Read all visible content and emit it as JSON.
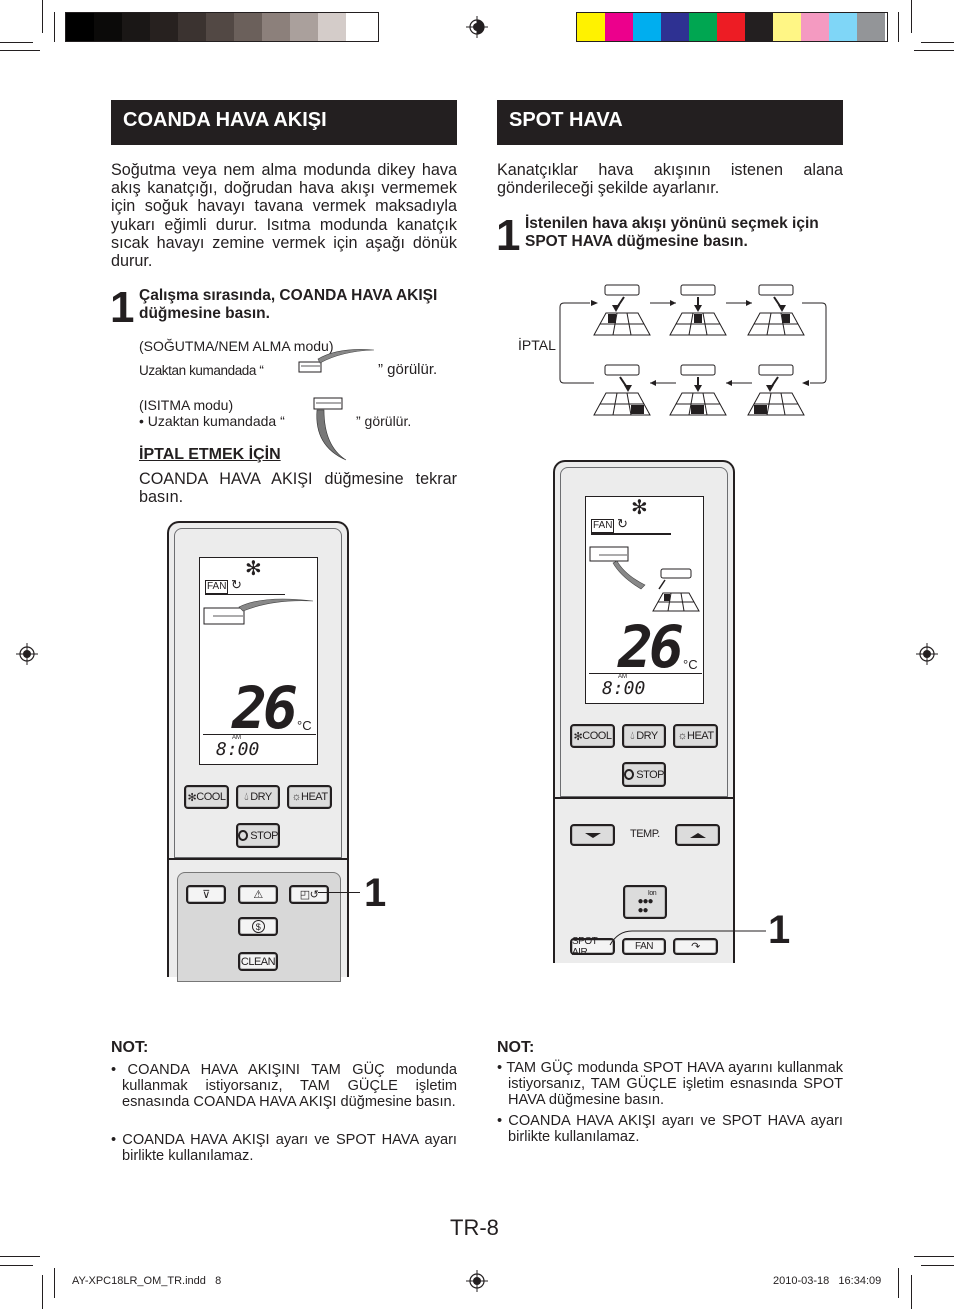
{
  "print_marks": {
    "gray_swatches": [
      "#000000",
      "#0b0a09",
      "#1a1716",
      "#27211f",
      "#3b3330",
      "#524844",
      "#6b605b",
      "#8c807b",
      "#aaa09c",
      "#d4ccc9",
      "#ffffff"
    ],
    "color_swatches": [
      "#fff200",
      "#ec008c",
      "#00aeef",
      "#2e3192",
      "#00a651",
      "#ed1c24",
      "#231f20",
      "#fff685",
      "#f49ac1",
      "#7fd6f7",
      "#939598"
    ]
  },
  "left": {
    "header": "COANDA HAVA AKIŞI",
    "intro": "Soğutma veya nem alma modunda dikey hava akış kanatçığı, doğrudan hava akışı vermemek için soğuk havayı tavana vermek maksadıyla yukarı eğimli durur. Isıtma modunda kanatçık sıcak havayı zemine vermek için aşağı dönük durur.",
    "step_number": "1",
    "step_text": "Çalışma sırasında, COANDA HAVA AKIŞI düğmesine basın.",
    "cool_mode_label": "(SOĞUTMA/NEM ALMA modu)",
    "cool_mode_line_a": "Uzaktan kumandada “",
    "cool_mode_line_b": "” görülür.",
    "heat_mode_label": "(ISITMA  modu)",
    "heat_mode_line_a": "• Uzaktan kumandada “",
    "heat_mode_line_b": "” görülür.",
    "cancel_heading": "İPTAL ETMEK İÇİN",
    "cancel_text": "COANDA HAVA AKIŞI düğmesine tekrar basın.",
    "remote": {
      "fan_label": "FAN",
      "temperature": "26",
      "unit": "°C",
      "am": "AM",
      "clock": "8:00",
      "buttons": {
        "cool": "COOL",
        "dry": "DRY",
        "heat": "HEAT",
        "stop": "STOP",
        "clean": "CLEAN"
      },
      "callout": "1"
    },
    "note_heading": "NOT:",
    "notes": [
      "• COANDA HAVA AKIŞINI TAM GÜÇ modunda kullanmak istiyorsanız, TAM GÜÇLE işletim esnasında COANDA HAVA AKIŞI düğmesine basın.",
      "• COANDA HAVA AKIŞI ayarı ve SPOT HAVA ayarı birlikte kullanılamaz."
    ]
  },
  "right": {
    "header": "SPOT HAVA",
    "intro": "Kanatçıklar hava akışının istenen alana gönderileceği şekilde ayarlanır.",
    "step_number": "1",
    "step_text": "İstenilen hava akışı yönünü seçmek için SPOT HAVA düğmesine basın.",
    "diagram": {
      "cancel_label": "İPTAL",
      "sequence": [
        "top-left",
        "top-center",
        "top-right",
        "bottom-left",
        "bottom-center",
        "bottom-right"
      ]
    },
    "remote": {
      "fan_label": "FAN",
      "temperature": "26",
      "unit": "°C",
      "am": "AM",
      "clock": "8:00",
      "buttons": {
        "cool": "COOL",
        "dry": "DRY",
        "heat": "HEAT",
        "stop": "STOP",
        "temp": "TEMP.",
        "ion": "Ion",
        "spot_air": "SPOT AIR",
        "fan": "FAN"
      },
      "callout": "1"
    },
    "note_heading": "NOT:",
    "notes": [
      "• TAM GÜÇ modunda SPOT HAVA ayarını kullanmak istiyorsanız, TAM GÜÇLE işletim esnasında SPOT HAVA düğmesine basın.",
      "• COANDA HAVA AKIŞI ayarı ve SPOT HAVA ayarı birlikte kullanılamaz."
    ]
  },
  "footer": {
    "page_number": "TR-8",
    "file_name": "AY-XPC18LR_OM_TR.indd   8",
    "timestamp": "2010-03-18   16:34:09"
  }
}
